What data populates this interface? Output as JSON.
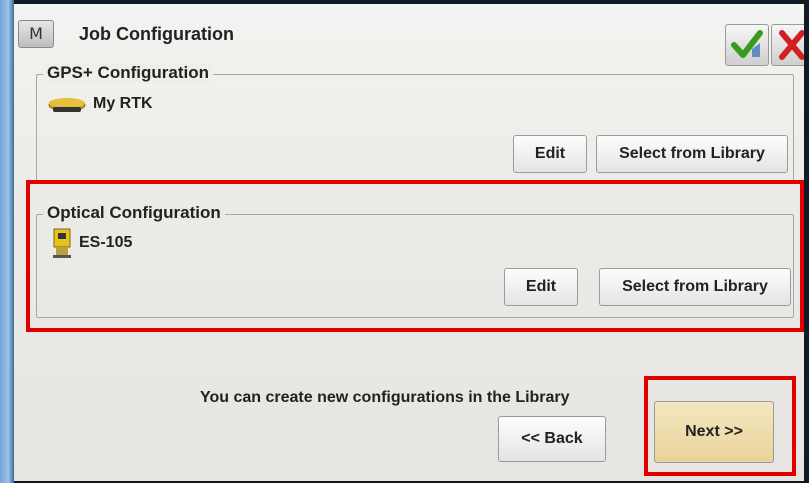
{
  "window": {
    "title": "Job Configuration",
    "menu_label": "M"
  },
  "gps_group": {
    "legend": "GPS+ Configuration",
    "config_name": "My RTK",
    "icon": "gps-receiver-icon",
    "edit_label": "Edit",
    "library_label": "Select from Library"
  },
  "optical_group": {
    "legend": "Optical Configuration",
    "config_name": "ES-105",
    "icon": "total-station-icon",
    "edit_label": "Edit",
    "library_label": "Select from Library"
  },
  "footer": {
    "info": "You can create new configurations in the Library",
    "back_label": "<< Back",
    "next_label": "Next >>"
  },
  "colors": {
    "highlight": "#e00000",
    "ok_check": "#3a9a1e",
    "cancel_x": "#d12020"
  }
}
